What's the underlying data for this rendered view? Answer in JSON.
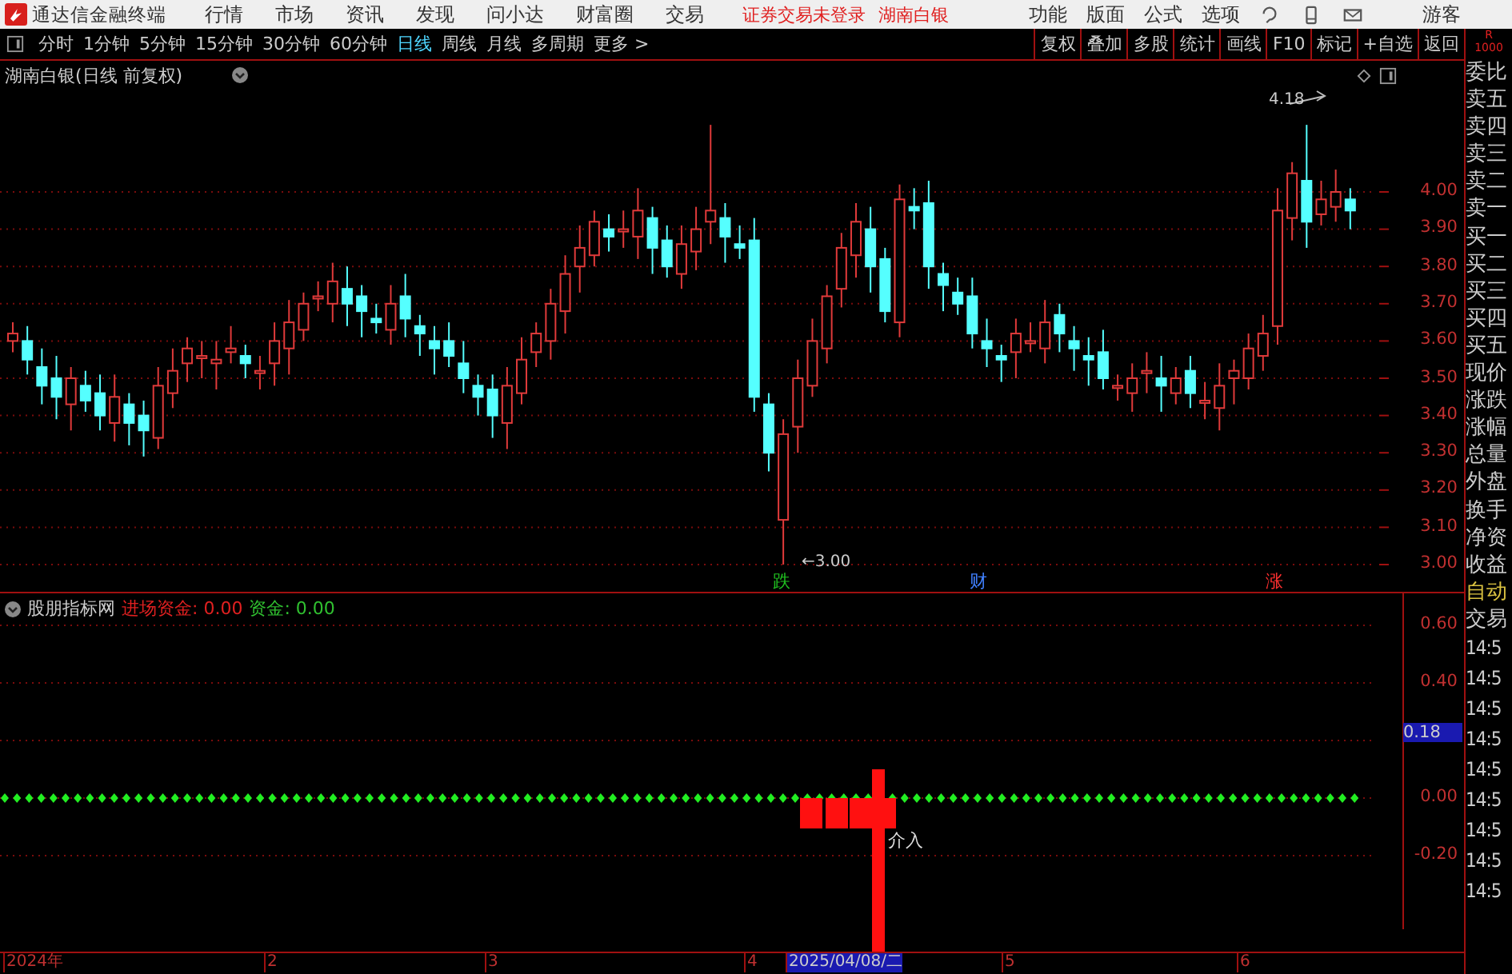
{
  "app": {
    "title": "通达信金融终端",
    "menu": [
      "行情",
      "市场",
      "资讯",
      "发现",
      "问小达",
      "财富圈",
      "交易"
    ],
    "notice": "证券交易未登录",
    "stock_name": "湖南白银",
    "menu_right": [
      "功能",
      "版面",
      "公式",
      "选项"
    ],
    "user": "游客"
  },
  "periods": [
    {
      "label": "分时",
      "selected": false
    },
    {
      "label": "1分钟",
      "selected": false
    },
    {
      "label": "5分钟",
      "selected": false
    },
    {
      "label": "15分钟",
      "selected": false
    },
    {
      "label": "30分钟",
      "selected": false
    },
    {
      "label": "60分钟",
      "selected": false
    },
    {
      "label": "日线",
      "selected": true
    },
    {
      "label": "周线",
      "selected": false
    },
    {
      "label": "月线",
      "selected": false
    },
    {
      "label": "多周期",
      "selected": false
    },
    {
      "label": "更多 >",
      "selected": false
    }
  ],
  "tools": [
    "复权",
    "叠加",
    "多股",
    "统计",
    "画线",
    "F10",
    "标记",
    "+自选",
    "返回"
  ],
  "corner": [
    "R",
    "1000"
  ],
  "main_chart": {
    "title": "湖南白银(日线 前复权)",
    "y_ticks": [
      "4.00",
      "3.90",
      "3.80",
      "3.70",
      "3.60",
      "3.50",
      "3.40",
      "3.30",
      "3.20",
      "3.10",
      "3.00"
    ],
    "high_label": "4.18",
    "low_label": "←3.00",
    "events": [
      {
        "label": "跌",
        "color": "#20c020"
      },
      {
        "label": "财",
        "color": "#4080ff"
      },
      {
        "label": "涨",
        "color": "#ff3030"
      }
    ]
  },
  "quote_panel": [
    "委比",
    "卖五",
    "卖四",
    "卖三",
    "卖二",
    "卖一",
    "买一",
    "买二",
    "买三",
    "买四",
    "买五",
    "现价",
    "涨跌",
    "涨幅",
    "总量",
    "外盘",
    "换手",
    "净资",
    "收益"
  ],
  "indicator": {
    "name": "股朋指标网",
    "fields": [
      {
        "label": "进场资金:",
        "value": "0.00",
        "color": "#e02020"
      },
      {
        "label": "资金:",
        "value": "0.00",
        "color": "#30c030"
      }
    ],
    "y_ticks": [
      "0.60",
      "0.40",
      "0.00",
      "-0.20"
    ],
    "cursor_value": "0.18",
    "signal_label": "介入"
  },
  "side_panel": {
    "items": [
      "自动",
      "交易"
    ],
    "times": [
      "14:5",
      "14:5",
      "14:5",
      "14:5",
      "14:5",
      "14:5",
      "14:5",
      "14:5",
      "14:5"
    ]
  },
  "time_axis": [
    {
      "label": "2024年",
      "selected": false
    },
    {
      "label": "2",
      "selected": false
    },
    {
      "label": "3",
      "selected": false
    },
    {
      "label": "4",
      "selected": false
    },
    {
      "label": "2025/04/08/二",
      "selected": true
    },
    {
      "label": "5",
      "selected": false
    },
    {
      "label": "6",
      "selected": false
    }
  ]
}
